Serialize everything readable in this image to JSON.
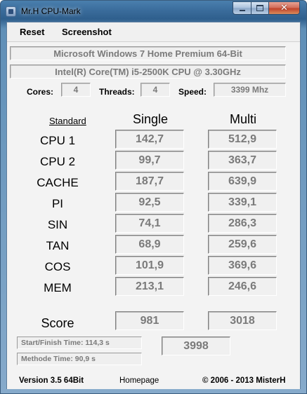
{
  "window": {
    "title": "Mr.H CPU-Mark",
    "close_glyph": "✕"
  },
  "menu": {
    "reset": "Reset",
    "screenshot": "Screenshot"
  },
  "system": {
    "os": "Microsoft Windows 7 Home Premium  64-Bit",
    "cpu": "Intel(R) Core(TM) i5-2500K CPU @ 3.30GHz",
    "cores_label": "Cores:",
    "cores": "4",
    "threads_label": "Threads:",
    "threads": "4",
    "speed_label": "Speed:",
    "speed": "3399 Mhz"
  },
  "bench": {
    "standard_link": "Standard",
    "single_header": "Single",
    "multi_header": "Multi",
    "rows": [
      {
        "label": "CPU 1",
        "single": "142,7",
        "multi": "512,9"
      },
      {
        "label": "CPU 2",
        "single": "99,7",
        "multi": "363,7"
      },
      {
        "label": "CACHE",
        "single": "187,7",
        "multi": "639,9"
      },
      {
        "label": "PI",
        "single": "92,5",
        "multi": "339,1"
      },
      {
        "label": "SIN",
        "single": "74,1",
        "multi": "286,3"
      },
      {
        "label": "TAN",
        "single": "68,9",
        "multi": "259,6"
      },
      {
        "label": "COS",
        "single": "101,9",
        "multi": "369,6"
      },
      {
        "label": "MEM",
        "single": "213,1",
        "multi": "246,6"
      }
    ],
    "score_label": "Score",
    "score_single": "981",
    "score_multi": "3018",
    "total": "3998"
  },
  "timing": {
    "start_finish": "Start/Finish Time: 114,3 s",
    "methode": "Methode Time: 90,9 s"
  },
  "footer": {
    "version": "Version 3.5   64Bit",
    "homepage": "Homepage",
    "copyright": "© 2006 - 2013 MisterH"
  }
}
